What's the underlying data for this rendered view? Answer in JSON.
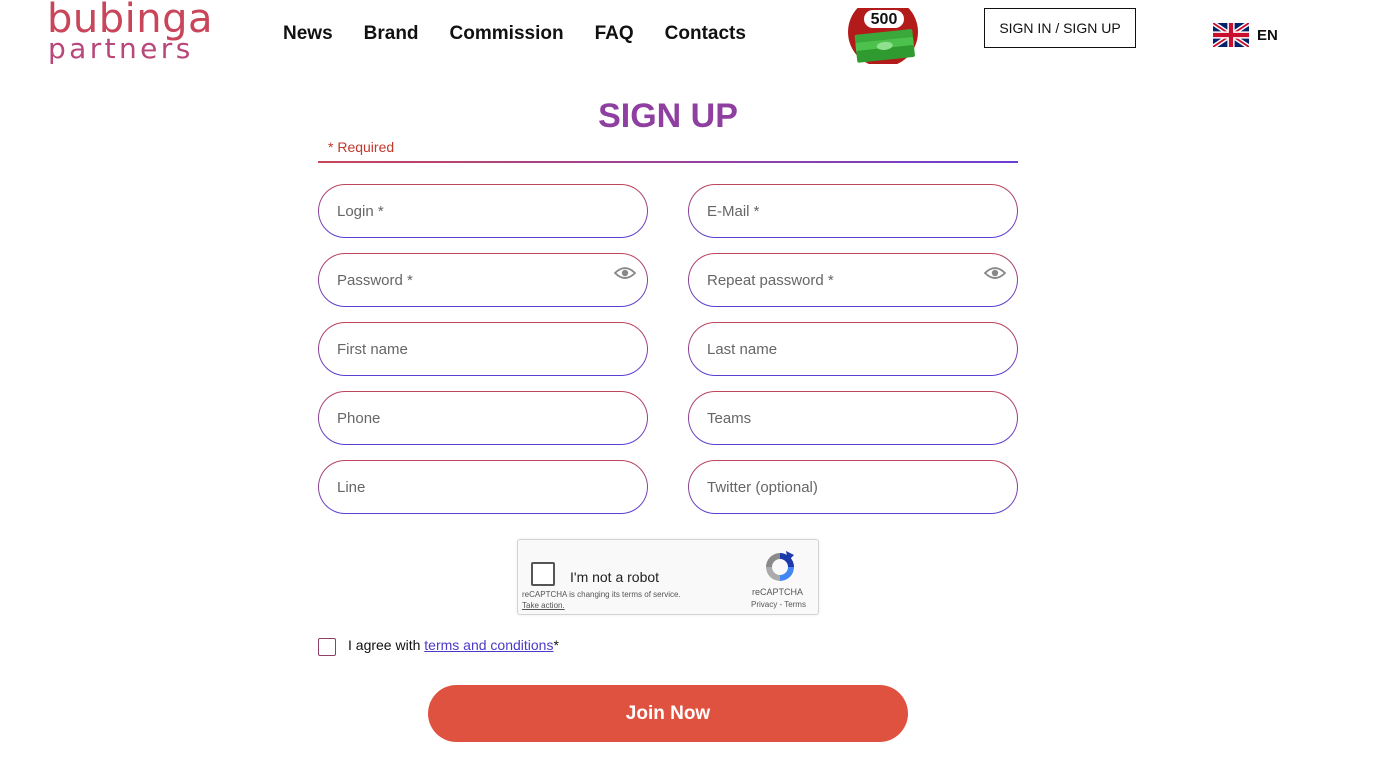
{
  "logo": {
    "line1": "bubinga",
    "line2": "partners"
  },
  "nav": [
    "News",
    "Brand",
    "Commission",
    "FAQ",
    "Contacts"
  ],
  "bonus": {
    "amount": "500"
  },
  "header": {
    "signin_label": "SIGN IN / SIGN UP",
    "lang_code": "EN"
  },
  "form": {
    "title": "SIGN UP",
    "required_note": "* Required",
    "fields": {
      "login": "Login *",
      "email": "E-Mail *",
      "password": "Password *",
      "repeat_password": "Repeat password *",
      "first_name": "First name",
      "last_name": "Last name",
      "phone": "Phone",
      "teams": "Teams",
      "line": "Line",
      "twitter": "Twitter (optional)"
    },
    "agree_text": "I agree with",
    "terms_link": "terms and conditions",
    "agree_required_mark": "*",
    "submit_label": "Join Now"
  },
  "captcha": {
    "label": "I'm not a robot",
    "notice": "reCAPTCHA is changing its terms of service.",
    "action": "Take action.",
    "brand": "reCAPTCHA",
    "privacy_terms": "Privacy - Terms"
  },
  "colors": {
    "accent_purple": "#8e3fa0",
    "button_red": "#e05240",
    "required_red": "#c0392b"
  }
}
